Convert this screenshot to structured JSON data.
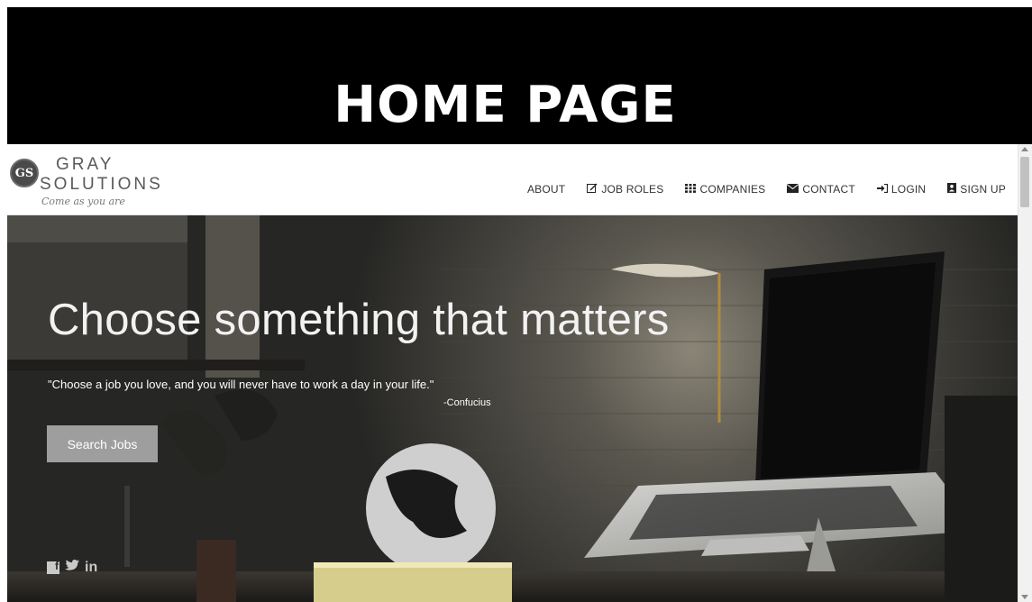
{
  "slide": {
    "title": "HOME PAGE"
  },
  "header": {
    "logo_monogram": "GS",
    "logo_line1": "GRAY",
    "logo_line2": "SOLUTIONS",
    "logo_tagline": "Come as you are"
  },
  "nav": {
    "items": [
      {
        "label": "ABOUT",
        "icon": ""
      },
      {
        "label": "JOB ROLES",
        "icon": "edit-icon"
      },
      {
        "label": "COMPANIES",
        "icon": "grid-icon"
      },
      {
        "label": "CONTACT",
        "icon": "envelope-icon"
      },
      {
        "label": "LOGIN",
        "icon": "sign-in-icon"
      },
      {
        "label": "SIGN UP",
        "icon": "user-icon"
      }
    ]
  },
  "hero": {
    "heading": "Choose something that matters",
    "quote": "\"Choose a job you love, and you will never have to work a day in your life.\"",
    "author": "-Confucius",
    "button_label": "Search Jobs"
  },
  "social": {
    "icons": [
      "facebook-icon",
      "twitter-icon",
      "linkedin-icon"
    ],
    "linkedin_text": "in"
  },
  "colors": {
    "slide_bg": "#000000",
    "button_bg": "#9e9e9e",
    "nav_text": "#333333"
  }
}
